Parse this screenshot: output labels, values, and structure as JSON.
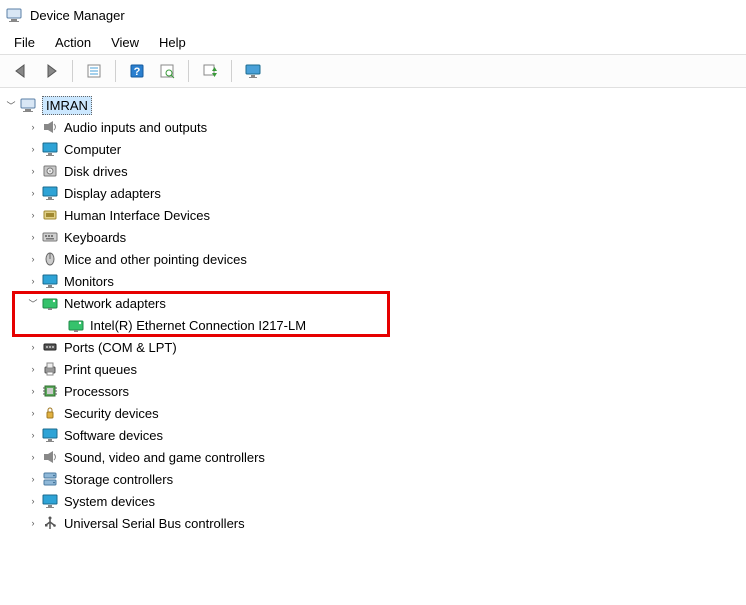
{
  "window": {
    "title": "Device Manager"
  },
  "menu": {
    "file": "File",
    "action": "Action",
    "view": "View",
    "help": "Help"
  },
  "tree": {
    "root": "IMRAN",
    "items": [
      {
        "label": "Audio inputs and outputs",
        "icon": "speaker"
      },
      {
        "label": "Computer",
        "icon": "monitor"
      },
      {
        "label": "Disk drives",
        "icon": "disk"
      },
      {
        "label": "Display adapters",
        "icon": "monitor"
      },
      {
        "label": "Human Interface Devices",
        "icon": "hid"
      },
      {
        "label": "Keyboards",
        "icon": "keyboard"
      },
      {
        "label": "Mice and other pointing devices",
        "icon": "mouse"
      },
      {
        "label": "Monitors",
        "icon": "monitor"
      },
      {
        "label": "Network adapters",
        "icon": "network",
        "expanded": true,
        "highlight": true,
        "children": [
          {
            "label": "Intel(R) Ethernet Connection I217-LM",
            "icon": "network"
          }
        ]
      },
      {
        "label": "Ports (COM & LPT)",
        "icon": "port"
      },
      {
        "label": "Print queues",
        "icon": "printer"
      },
      {
        "label": "Processors",
        "icon": "cpu"
      },
      {
        "label": "Security devices",
        "icon": "security"
      },
      {
        "label": "Software devices",
        "icon": "monitor"
      },
      {
        "label": "Sound, video and game controllers",
        "icon": "speaker"
      },
      {
        "label": "Storage controllers",
        "icon": "storage"
      },
      {
        "label": "System devices",
        "icon": "monitor"
      },
      {
        "label": "Universal Serial Bus controllers",
        "icon": "usb"
      }
    ]
  }
}
